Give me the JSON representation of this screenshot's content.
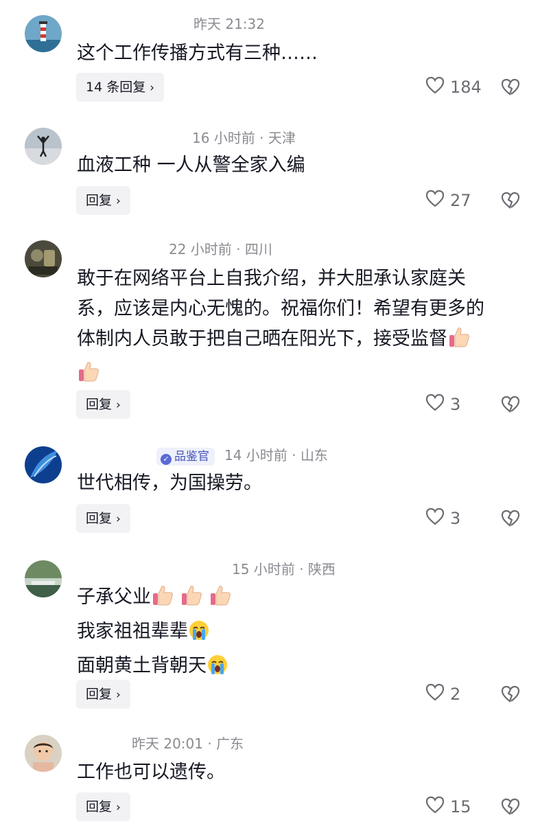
{
  "comments": [
    {
      "meta": "昨天 21:32",
      "lines": [
        "这个工作传播方式有三种……"
      ],
      "reply_label": "14 条回复",
      "likes": "184"
    },
    {
      "meta": "16 小时前 · 天津",
      "lines": [
        "血液工种 一人从警全家入编"
      ],
      "reply_label": "回复",
      "likes": "27"
    },
    {
      "meta": "22 小时前 · 四川",
      "lines": [
        "敢于在网络平台上自我介绍，并大胆承认家庭关",
        "系，应该是内心无愧的。祝福你们！希望有更多的",
        "体制内人员敢于把自己晒在阳光下，接受监督"
      ],
      "reply_label": "回复",
      "likes": "3"
    },
    {
      "badge": "品鉴官",
      "meta": "14 小时前 · 山东",
      "lines": [
        "世代相传，为国操劳。"
      ],
      "reply_label": "回复",
      "likes": "3"
    },
    {
      "meta": "15 小时前 · 陕西",
      "lines": [
        "子承父业",
        "我家祖祖辈辈",
        "面朝黄土背朝天"
      ],
      "reply_label": "回复",
      "likes": "2"
    },
    {
      "meta": "昨天 20:01 · 广东",
      "lines": [
        "工作也可以遗传。"
      ],
      "reply_label": "回复",
      "likes": "15"
    }
  ],
  "icons": {
    "like": "heart-outline-icon",
    "dislike": "broken-heart-icon",
    "thumbs_up": "thumbs-up-emoji",
    "crying": "loudly-crying-emoji",
    "verified": "verified-check-icon"
  },
  "colors": {
    "meta_text": "#8a8b91",
    "body_text": "#161823",
    "reply_bg": "#f2f2f4",
    "badge_bg": "#eef0fb",
    "badge_text": "#4a55b8"
  }
}
